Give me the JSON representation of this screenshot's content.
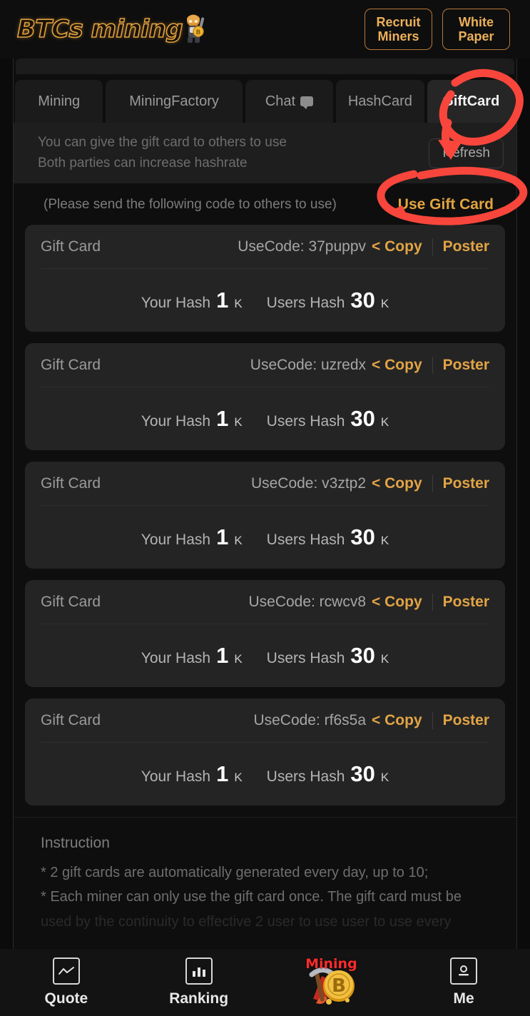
{
  "header": {
    "logo_text": "BTCs mining",
    "logo_icon": "miner-character-icon",
    "recruit_label": "Recruit\nMiners",
    "recruit_line1": "Recruit",
    "recruit_line2": "Miners",
    "white_paper_line1": "White",
    "white_paper_line2": "Paper"
  },
  "tabs": [
    {
      "label": "Mining",
      "active": false
    },
    {
      "label": "MiningFactory",
      "active": false
    },
    {
      "label": "Chat",
      "active": false,
      "icon": "chat-bubble-icon"
    },
    {
      "label": "HashCard",
      "active": false
    },
    {
      "label": "GiftCard",
      "active": true
    }
  ],
  "notice": {
    "line1": "You can give the gift card to others to use",
    "line2": "Both parties can increase hashrate",
    "refresh_label": "Refresh"
  },
  "subhead": {
    "note": "(Please send the following code to others to use)",
    "use_gift_card_label": "Use Gift Card"
  },
  "card_labels": {
    "title": "Gift Card",
    "usecode_prefix": "UseCode:",
    "copy_label": "< Copy",
    "poster_label": "Poster",
    "your_hash_label": "Your Hash",
    "users_hash_label": "Users Hash",
    "unit": "K"
  },
  "cards": [
    {
      "title": "Gift Card",
      "usecode": "UseCode: 37puppv",
      "code": "37puppv",
      "copy": "< Copy",
      "poster": "Poster",
      "your_hash_label": "Your Hash",
      "your_hash": "1",
      "your_unit": "K",
      "users_hash_label": "Users Hash",
      "users_hash": "30",
      "users_unit": "K"
    },
    {
      "title": "Gift Card",
      "usecode": "UseCode: uzredx",
      "code": "uzredx",
      "copy": "< Copy",
      "poster": "Poster",
      "your_hash_label": "Your Hash",
      "your_hash": "1",
      "your_unit": "K",
      "users_hash_label": "Users Hash",
      "users_hash": "30",
      "users_unit": "K"
    },
    {
      "title": "Gift Card",
      "usecode": "UseCode: v3ztp2",
      "code": "v3ztp2",
      "copy": "< Copy",
      "poster": "Poster",
      "your_hash_label": "Your Hash",
      "your_hash": "1",
      "your_unit": "K",
      "users_hash_label": "Users Hash",
      "users_hash": "30",
      "users_unit": "K"
    },
    {
      "title": "Gift Card",
      "usecode": "UseCode: rcwcv8",
      "code": "rcwcv8",
      "copy": "< Copy",
      "poster": "Poster",
      "your_hash_label": "Your Hash",
      "your_hash": "1",
      "your_unit": "K",
      "users_hash_label": "Users Hash",
      "users_hash": "30",
      "users_unit": "K"
    },
    {
      "title": "Gift Card",
      "usecode": "UseCode: rf6s5a",
      "code": "rf6s5a",
      "copy": "< Copy",
      "poster": "Poster",
      "your_hash_label": "Your Hash",
      "your_hash": "1",
      "your_unit": "K",
      "users_hash_label": "Users Hash",
      "users_hash": "30",
      "users_unit": "K"
    }
  ],
  "instruction": {
    "title": "Instruction",
    "lines": [
      "* 2 gift cards are automatically generated every day, up to 10;",
      "* Each miner can only use the gift card once. The gift card must be",
      "used by the continuity to effective 2 user to use user to use every"
    ]
  },
  "bottom_nav": [
    {
      "label": "Quote",
      "icon": "line-chart-icon",
      "active": false
    },
    {
      "label": "Ranking",
      "icon": "bar-chart-icon",
      "active": false
    },
    {
      "label": "Mining",
      "icon": "bitcoin-pickaxe-icon",
      "active": true
    },
    {
      "label": "Me",
      "icon": "person-icon",
      "active": false
    }
  ],
  "annotations": [
    {
      "name": "giftcard-tab-circle",
      "shape": "ellipse-with-arrow",
      "color": "#f8463c"
    },
    {
      "name": "use-gift-card-circle",
      "shape": "ellipse",
      "color": "#f8463c"
    }
  ],
  "colors": {
    "accent_gold": "#e2a445",
    "annotation_red": "#f8463c",
    "page_bg": "#0b0b0b",
    "card_bg": "#242424"
  }
}
